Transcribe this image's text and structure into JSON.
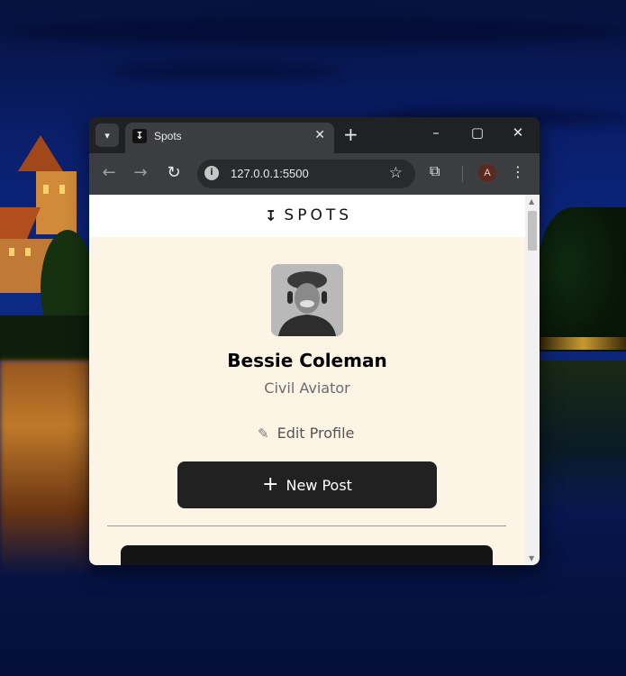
{
  "browser": {
    "tab_title": "Spots",
    "url": "127.0.0.1:5500",
    "profile_initial": "A"
  },
  "site": {
    "logo_text": "SPOTS",
    "profile": {
      "name": "Bessie Coleman",
      "role": "Civil Aviator"
    },
    "edit_profile_label": "Edit Profile",
    "new_post_label": "New Post"
  },
  "colors": {
    "page_background": "#fcf5e5",
    "button_dark": "#212121",
    "browser_chrome": "#202124"
  },
  "icons": {
    "tab_menu": "chevron-down-icon",
    "favicon": "spots-logo-icon",
    "close": "close-icon",
    "new_tab": "plus-icon",
    "minimize": "minimize-icon",
    "maximize": "maximize-icon",
    "window_close": "close-icon",
    "back": "arrow-left-icon",
    "forward": "arrow-right-icon",
    "reload": "reload-icon",
    "site_info": "info-icon",
    "bookmark": "star-icon",
    "extensions": "puzzle-icon",
    "menu": "kebab-icon",
    "edit": "pencil-icon",
    "add": "plus-icon"
  }
}
